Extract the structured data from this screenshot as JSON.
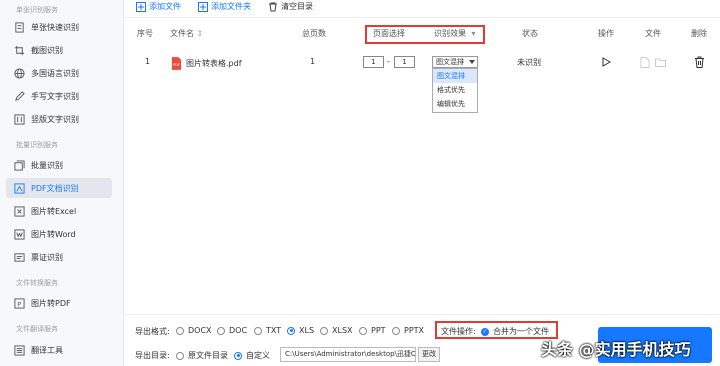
{
  "sidebar": {
    "sections": [
      {
        "title": "单张识别服务",
        "items": [
          {
            "label": "单张快速识别",
            "icon": "doc-scan-icon"
          },
          {
            "label": "截图识别",
            "icon": "crop-icon"
          },
          {
            "label": "多国语言识别",
            "icon": "globe-icon"
          },
          {
            "label": "手写文字识别",
            "icon": "pen-icon"
          },
          {
            "label": "竖版文字识别",
            "icon": "vertical-text-icon"
          }
        ]
      },
      {
        "title": "批量识别服务",
        "items": [
          {
            "label": "批量识别",
            "icon": "batch-icon"
          },
          {
            "label": "PDF文档识别",
            "icon": "pdf-doc-icon",
            "active": true
          },
          {
            "label": "图片转Excel",
            "icon": "excel-icon"
          },
          {
            "label": "图片转Word",
            "icon": "word-icon"
          },
          {
            "label": "票证识别",
            "icon": "ticket-icon"
          }
        ]
      },
      {
        "title": "文件转换服务",
        "items": [
          {
            "label": "图片转PDF",
            "icon": "image-pdf-icon"
          }
        ]
      },
      {
        "title": "文件翻译服务",
        "items": [
          {
            "label": "翻译工具",
            "icon": "translate-icon"
          }
        ]
      }
    ]
  },
  "toolbar": {
    "add_file": "添加文件",
    "add_folder": "添加文件夹",
    "clear": "清空目录"
  },
  "table": {
    "headers": {
      "index": "序号",
      "filename": "文件名",
      "pages": "总页数",
      "page_select": "页面选择",
      "effect": "识别效果",
      "status": "状态",
      "action": "操作",
      "file": "文件",
      "delete": "删除"
    },
    "rows": [
      {
        "index": "1",
        "filename": "图片转表格.pdf",
        "pages": "1",
        "page_from": "1",
        "page_sep": "-",
        "page_to": "1",
        "effect": "图文混排",
        "status": "未识别"
      }
    ],
    "effect_options": [
      "图文混排",
      "格式优先",
      "编辑优先"
    ]
  },
  "bottom": {
    "format_label": "导出格式:",
    "formats": [
      {
        "label": "DOCX",
        "checked": false
      },
      {
        "label": "DOC",
        "checked": false
      },
      {
        "label": "TXT",
        "checked": false
      },
      {
        "label": "XLS",
        "checked": true
      },
      {
        "label": "XLSX",
        "checked": false
      },
      {
        "label": "PPT",
        "checked": false
      },
      {
        "label": "PPTX",
        "checked": false
      }
    ],
    "file_op_label": "文件操作:",
    "merge_label": "合并为一个文件",
    "dir_label": "导出目录:",
    "dir_source": "原文件目录",
    "dir_custom": "自定义",
    "dir_path": "C:\\Users\\Administrator\\desktop\\迅捷OCRS",
    "change_btn": "更改"
  },
  "watermark": "头条 @实用手机技巧",
  "colors": {
    "accent": "#1677ff",
    "highlight": "#e53935"
  }
}
